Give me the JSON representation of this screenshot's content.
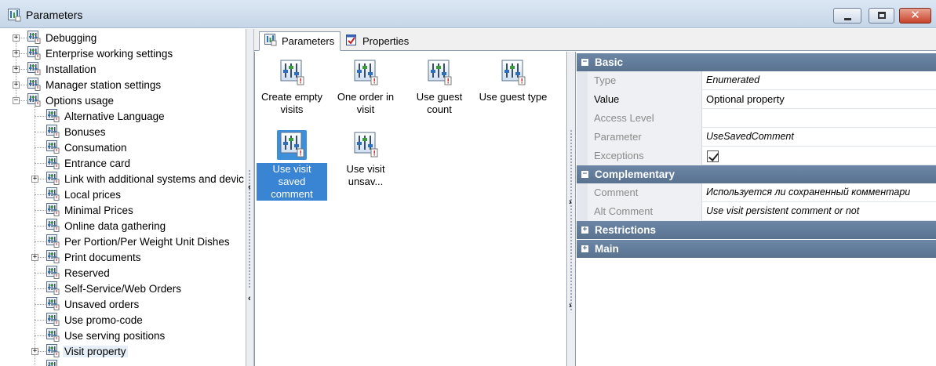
{
  "window": {
    "title": "Parameters"
  },
  "tree": {
    "items": [
      {
        "label": "Debugging",
        "level": 0,
        "expander": "+"
      },
      {
        "label": "Enterprise working settings",
        "level": 0,
        "expander": "+"
      },
      {
        "label": "Installation",
        "level": 0,
        "expander": "+"
      },
      {
        "label": "Manager station settings",
        "level": 0,
        "expander": "+"
      },
      {
        "label": "Options usage",
        "level": 0,
        "expander": "-"
      },
      {
        "label": "Alternative Language",
        "level": 1,
        "expander": ""
      },
      {
        "label": "Bonuses",
        "level": 1,
        "expander": ""
      },
      {
        "label": "Consumation",
        "level": 1,
        "expander": ""
      },
      {
        "label": "Entrance card",
        "level": 1,
        "expander": ""
      },
      {
        "label": "Link with additional systems and devic",
        "level": 1,
        "expander": "+"
      },
      {
        "label": "Local prices",
        "level": 1,
        "expander": ""
      },
      {
        "label": "Minimal Prices",
        "level": 1,
        "expander": ""
      },
      {
        "label": "Online data gathering",
        "level": 1,
        "expander": ""
      },
      {
        "label": "Per Portion/Per Weight Unit Dishes",
        "level": 1,
        "expander": ""
      },
      {
        "label": "Print documents",
        "level": 1,
        "expander": "+"
      },
      {
        "label": "Reserved",
        "level": 1,
        "expander": ""
      },
      {
        "label": "Self-Service/Web Orders",
        "level": 1,
        "expander": ""
      },
      {
        "label": "Unsaved orders",
        "level": 1,
        "expander": ""
      },
      {
        "label": "Use promo-code",
        "level": 1,
        "expander": ""
      },
      {
        "label": "Use serving positions",
        "level": 1,
        "expander": ""
      },
      {
        "label": "Visit property",
        "level": 1,
        "expander": "+",
        "selected": true
      }
    ]
  },
  "tabs": [
    {
      "label": "Parameters",
      "active": true
    },
    {
      "label": "Properties",
      "active": false
    }
  ],
  "params": [
    {
      "label": "Create empty visits"
    },
    {
      "label": "One order in visit"
    },
    {
      "label": "Use guest count"
    },
    {
      "label": "Use guest type"
    },
    {
      "label": "Use visit saved comment",
      "selected": true
    },
    {
      "label": "Use visit unsav..."
    }
  ],
  "grid": {
    "basic_label": "Basic",
    "type_name": "Type",
    "type_value": "Enumerated",
    "value_name": "Value",
    "value_value": "Optional property",
    "access_name": "Access Level",
    "access_value": "",
    "parameter_name": "Parameter",
    "parameter_value": "UseSavedComment",
    "exceptions_name": "Exceptions",
    "exceptions_checked": true,
    "complementary_label": "Complementary",
    "comment_name": "Comment",
    "comment_value": "Используется ли сохраненный комментари",
    "altcomment_name": "Alt Comment",
    "altcomment_value": "Use visit persistent comment or not",
    "restrictions_label": "Restrictions",
    "main_label": "Main"
  },
  "colors": {
    "selection": "#3a84d4",
    "category": "#6d86a6"
  }
}
